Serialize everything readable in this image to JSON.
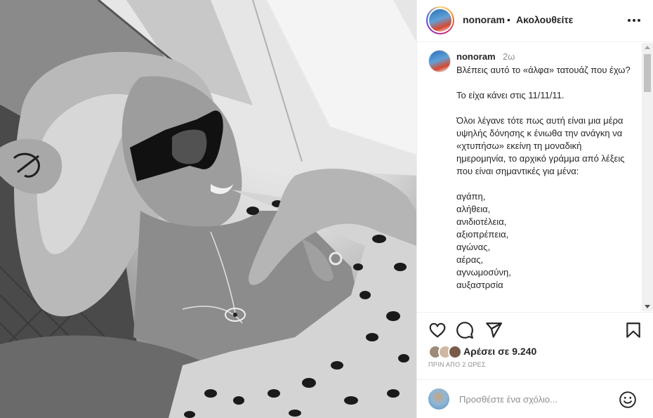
{
  "post": {
    "username": "nonoram",
    "separator": "•",
    "follow_label": "Ακολουθείτε",
    "more_icon": "more-icon"
  },
  "caption": {
    "username": "nonoram",
    "time_ago": "2ω",
    "lines": [
      "Βλέπεις αυτό το «άλφα» τατουάζ που έχω?",
      "",
      "Το είχα κάνει στις 11/11/11.",
      "",
      "Όλοι λέγανε τότε πως αυτή είναι μια μέρα υψηλής δόνησης κ ένιωθα την ανάγκη να «χτυπήσω» εκείνη τη μοναδική ημερομηνία, το αρχικό γράμμα από λέξεις που είναι σημαντικές για μένα:",
      "",
      "αγάπη,",
      "αλήθεια,",
      "ανιδιοτέλεια,",
      "αξιοπρέπεια,",
      "αγώνας,",
      "αέρας,",
      "αγνωμοσύνη,",
      "αυξαστρσία"
    ]
  },
  "actions": {
    "like_icon": "heart-icon",
    "comment_icon": "comment-icon",
    "share_icon": "send-icon",
    "save_icon": "bookmark-icon"
  },
  "likes": {
    "text": "Αρέσει σε 9.240"
  },
  "timestamp": "ΠΡΙΝ ΑΠΟ 2 ΩΡΕΣ",
  "comment": {
    "placeholder": "Προσθέστε ένα σχόλιο...",
    "emoji_icon": "emoji-icon"
  },
  "colors": {
    "text": "#262626",
    "muted": "#8e8e8e",
    "border": "#efefef"
  }
}
